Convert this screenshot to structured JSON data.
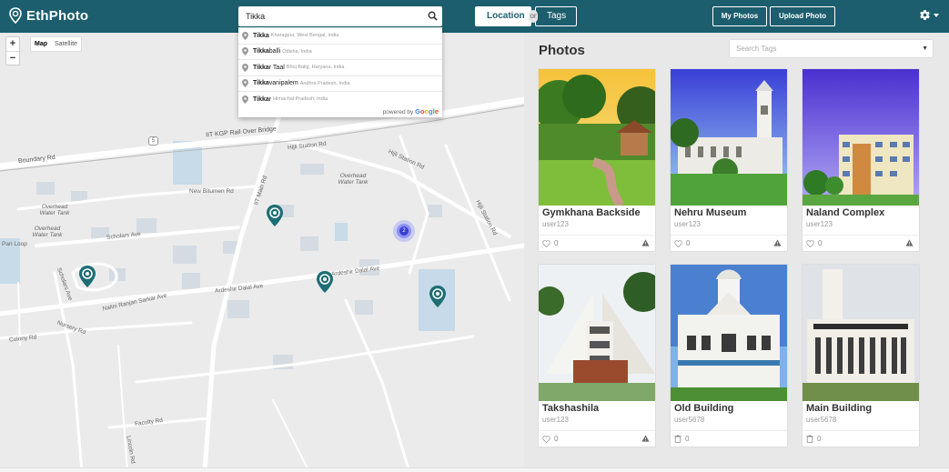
{
  "header": {
    "brand": "EthPhoto",
    "search_value": "Tikka",
    "toggle_location": "Location",
    "toggle_or": "or",
    "toggle_tags": "Tags",
    "my_photos": "My Photos",
    "upload_photo": "Upload Photo",
    "colors": {
      "bar": "#1c5e6d"
    }
  },
  "map": {
    "zoom_in": "+",
    "zoom_out": "−",
    "type_map": "Map",
    "type_satellite": "Satellite",
    "labels": [
      "IIT KGP Rail Over Bridge",
      "Boundary Rd",
      "Hijli Station Rd",
      "Hijli Station Rd",
      "Overhead Water Tank",
      "New Bitumen Rd",
      "IIT Main Rd",
      "Overhead Water Tank",
      "Overhead Water Tank",
      "Scholars Ave",
      "Pan Loop",
      "Ardeshir Dalal Ave",
      "Ardeshir Dalal Ave",
      "Nalini Ranjan Sarkar Ave",
      "Nursery Rd",
      "Colony Rd",
      "Faculty Rd",
      "Scholars Ave",
      "Hijli Station Rd",
      "5",
      "Lincoln Rd"
    ],
    "cluster_count": "2"
  },
  "autocomplete": {
    "items": [
      {
        "match": "Tikka",
        "rest": "",
        "secondary": "Kharagpur, West Bengal, India"
      },
      {
        "match": "Tikka",
        "rest": "balli",
        "secondary": "Odisha, India"
      },
      {
        "match": "Tikka",
        "rest": "r Taal",
        "secondary": "Bhoj Balig, Haryana, India"
      },
      {
        "match": "Tikka",
        "rest": "vanipalem",
        "secondary": "Andhra Pradesh, India"
      },
      {
        "match": "Tikka",
        "rest": "r",
        "secondary": "Himachal Pradesh, India"
      }
    ],
    "powered_by": "powered by",
    "google": [
      "G",
      "o",
      "o",
      "g",
      "l",
      "e"
    ]
  },
  "photos": {
    "title": "Photos",
    "search_tags_placeholder": "Search Tags",
    "cards": [
      {
        "title": "Gymkhana Backside",
        "user": "user123",
        "likes": "0",
        "action_icon": "warning-icon"
      },
      {
        "title": "Nehru Museum",
        "user": "user123",
        "likes": "0",
        "action_icon": "warning-icon"
      },
      {
        "title": "Naland Complex",
        "user": "user123",
        "likes": "0",
        "action_icon": "warning-icon"
      },
      {
        "title": "Takshashila",
        "user": "user123",
        "likes": "0",
        "action_icon": "warning-icon"
      },
      {
        "title": "Old Building",
        "user": "user5678",
        "likes": "0",
        "action_icon": "trash-icon"
      },
      {
        "title": "Main Building",
        "user": "user5678",
        "likes": "0",
        "action_icon": "trash-icon"
      }
    ]
  }
}
